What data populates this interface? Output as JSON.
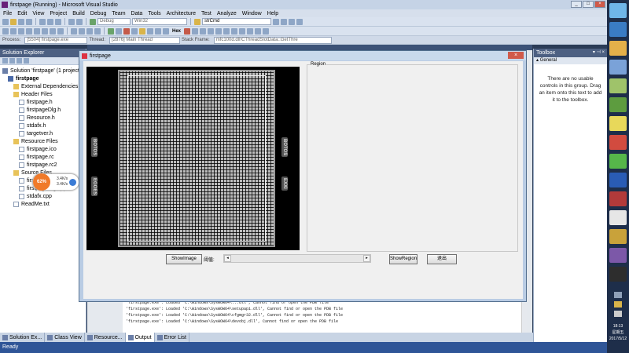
{
  "vs": {
    "title": "firstpage (Running) - Microsoft Visual Studio",
    "menu": [
      "File",
      "Edit",
      "View",
      "Project",
      "Build",
      "Debug",
      "Team",
      "Data",
      "Tools",
      "Architecture",
      "Test",
      "Analyze",
      "Window",
      "Help"
    ],
    "toolbar": {
      "config": "Debug",
      "platform": "Win32",
      "find": "strCmd",
      "hex_label": "Hex"
    },
    "debug_bar": {
      "process_label": "Process:",
      "process_value": "[5504] firstpage.exe",
      "thread_label": "Thread:",
      "thread_value": "[2876] Main Thread",
      "frame_label": "Stack Frame:",
      "frame_value": "mfc100d.dll!CThreadSlotData::GetThre"
    }
  },
  "solution_explorer": {
    "title": "Solution Explorer",
    "items": [
      {
        "label": "Solution 'firstpage' (1 project)",
        "kind": "sln",
        "indent": 0
      },
      {
        "label": "firstpage",
        "kind": "proj",
        "indent": 1,
        "bold": true
      },
      {
        "label": "External Dependencies",
        "kind": "folder",
        "indent": 2
      },
      {
        "label": "Header Files",
        "kind": "folder",
        "indent": 2
      },
      {
        "label": "firstpage.h",
        "kind": "file",
        "indent": 3
      },
      {
        "label": "firstpageDlg.h",
        "kind": "file",
        "indent": 3
      },
      {
        "label": "Resource.h",
        "kind": "file",
        "indent": 3
      },
      {
        "label": "stdafx.h",
        "kind": "file",
        "indent": 3
      },
      {
        "label": "targetver.h",
        "kind": "file",
        "indent": 3
      },
      {
        "label": "Resource Files",
        "kind": "folder",
        "indent": 2
      },
      {
        "label": "firstpage.ico",
        "kind": "file",
        "indent": 3
      },
      {
        "label": "firstpage.rc",
        "kind": "file",
        "indent": 3
      },
      {
        "label": "firstpage.rc2",
        "kind": "file",
        "indent": 3
      },
      {
        "label": "Source Files",
        "kind": "folder",
        "indent": 2
      },
      {
        "label": "firstpage.cpp",
        "kind": "file",
        "indent": 3
      },
      {
        "label": "firstpageDlg.cpp",
        "kind": "file",
        "indent": 3
      },
      {
        "label": "stdafx.cpp",
        "kind": "file",
        "indent": 3
      },
      {
        "label": "ReadMe.txt",
        "kind": "file",
        "indent": 2
      }
    ]
  },
  "cpu_widget": {
    "percent": "62%",
    "up": "3.4K/s",
    "down": "3.4K/s"
  },
  "bottom_tabs": [
    "Solution Ex...",
    "Class View",
    "Resource...",
    "Output",
    "Error List"
  ],
  "status": "Ready",
  "output_lines": [
    "'firstpage.exe': Loaded 'C:\\Windows\\SysWOW64\\...dll', Cannot find or open the PDB file",
    "'firstpage.exe': Loaded 'C:\\Windows\\SysWOW64\\setupapi.dll', Cannot find or open the PDB file",
    "'firstpage.exe': Loaded 'C:\\Windows\\SysWOW64\\cfgmgr32.dll', Cannot find or open the PDB file",
    "'firstpage.exe': Loaded 'C:\\Windows\\SysWOW64\\devobj.dll', Cannot find or open the PDB file"
  ],
  "toolbox": {
    "title": "Toolbox",
    "group": "General",
    "message": "There are no usable controls in this group. Drag an item onto this text to add it to the toolbox."
  },
  "dialog": {
    "title": "firstpage",
    "region_label": "Region",
    "chips": [
      "BOTOS",
      "EGOES",
      "BOTOS",
      "EXXI"
    ],
    "show_image": "ShowImage",
    "threshold_label": "阈值:",
    "show_region": "ShowRegion",
    "exit": "退出"
  },
  "clock": {
    "time": "18:13",
    "weekday": "星期五",
    "date": "2017/5/12"
  },
  "colors": {
    "status_bar": "#2f5597",
    "cpu_accent": "#f07a2a"
  }
}
